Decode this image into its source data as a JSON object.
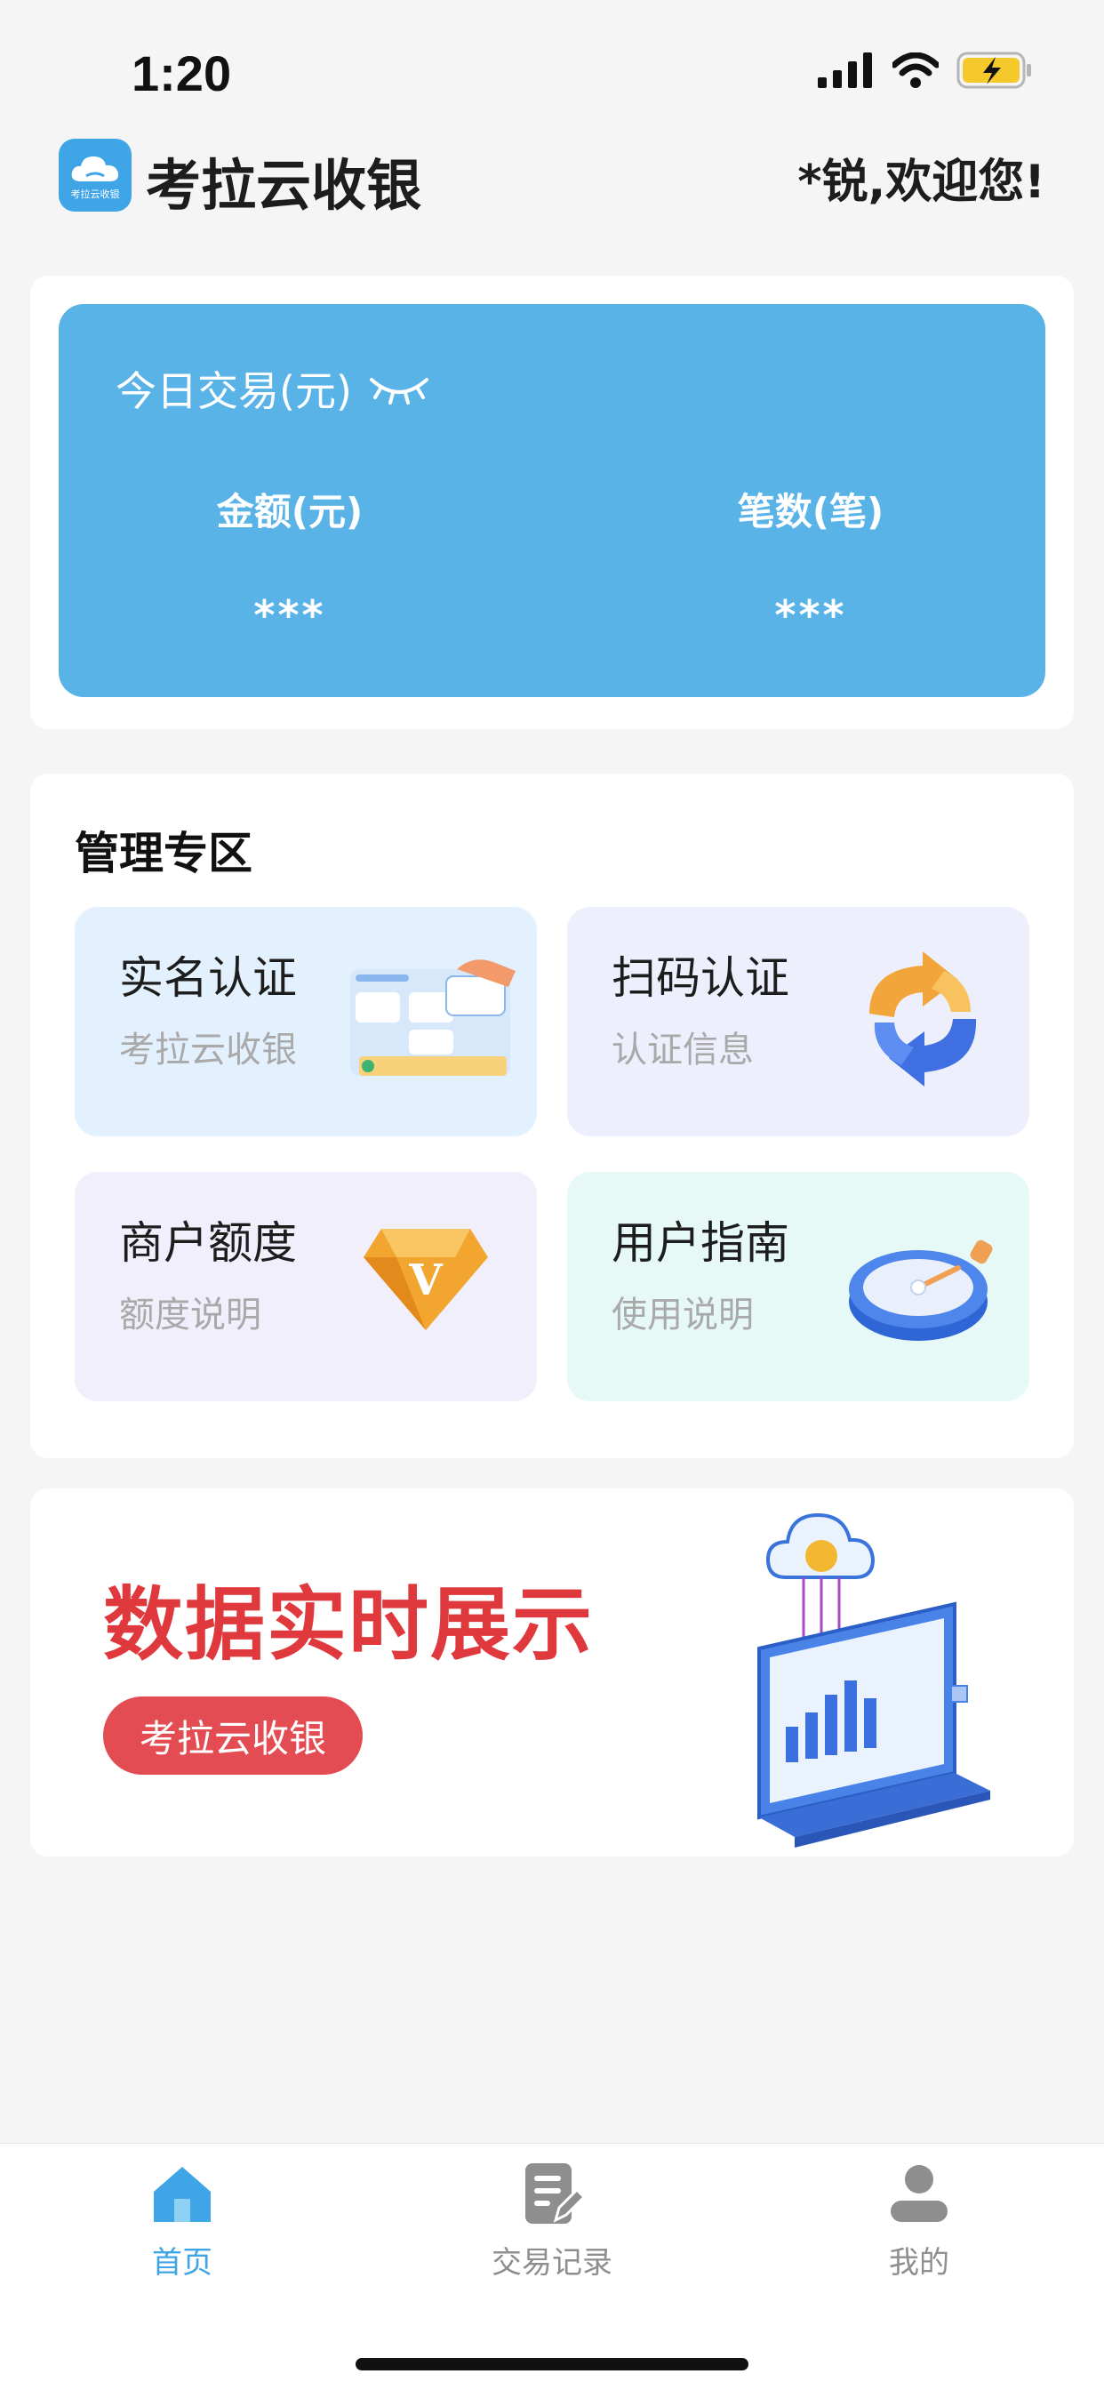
{
  "status_bar": {
    "time": "1:20"
  },
  "header": {
    "app_title": "考拉云收银",
    "logo_caption": "考拉云收银",
    "welcome": "*锐,欢迎您!"
  },
  "stats": {
    "title": "今日交易(元)",
    "amount_label": "金额(元)",
    "amount_value": "***",
    "count_label": "笔数(笔)",
    "count_value": "***"
  },
  "management": {
    "title": "管理专区",
    "tiles": [
      {
        "title": "实名认证",
        "subtitle": "考拉云收银"
      },
      {
        "title": "扫码认证",
        "subtitle": "认证信息"
      },
      {
        "title": "商户额度",
        "subtitle": "额度说明"
      },
      {
        "title": "用户指南",
        "subtitle": "使用说明"
      }
    ]
  },
  "banner": {
    "title": "数据实时展示",
    "button": "考拉云收银"
  },
  "tab_bar": {
    "tabs": [
      {
        "label": "首页",
        "icon": "home-icon",
        "active": true
      },
      {
        "label": "交易记录",
        "icon": "document-edit-icon",
        "active": false
      },
      {
        "label": "我的",
        "icon": "user-icon",
        "active": false
      }
    ]
  },
  "colors": {
    "accent": "#59b3e7",
    "active_tab": "#3fa5e6",
    "banner_red": "#e0393d",
    "inactive_tab": "#8e8e8e"
  }
}
